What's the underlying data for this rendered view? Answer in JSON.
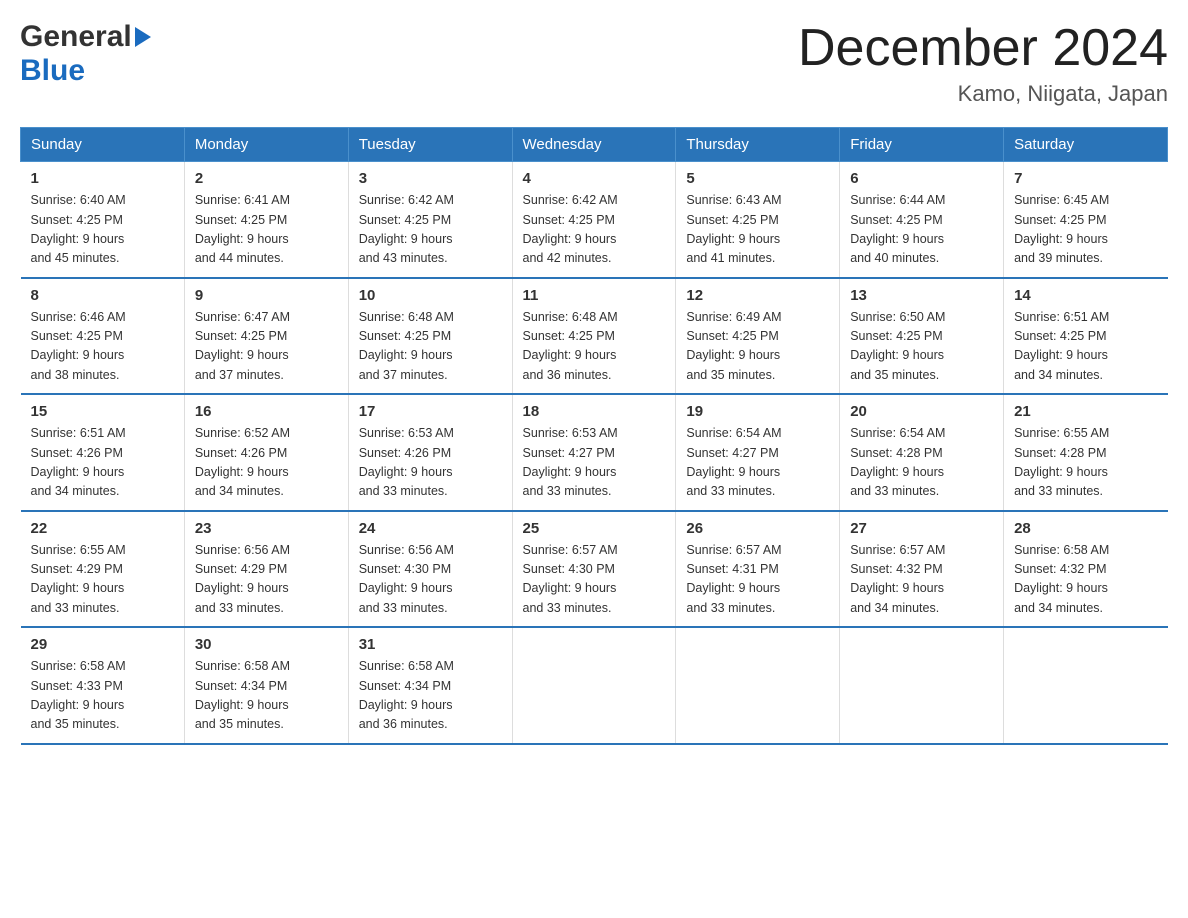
{
  "header": {
    "logo_general": "General",
    "logo_blue": "Blue",
    "title": "December 2024",
    "subtitle": "Kamo, Niigata, Japan"
  },
  "weekdays": [
    "Sunday",
    "Monday",
    "Tuesday",
    "Wednesday",
    "Thursday",
    "Friday",
    "Saturday"
  ],
  "weeks": [
    [
      {
        "day": "1",
        "sunrise": "6:40 AM",
        "sunset": "4:25 PM",
        "daylight": "9 hours and 45 minutes."
      },
      {
        "day": "2",
        "sunrise": "6:41 AM",
        "sunset": "4:25 PM",
        "daylight": "9 hours and 44 minutes."
      },
      {
        "day": "3",
        "sunrise": "6:42 AM",
        "sunset": "4:25 PM",
        "daylight": "9 hours and 43 minutes."
      },
      {
        "day": "4",
        "sunrise": "6:42 AM",
        "sunset": "4:25 PM",
        "daylight": "9 hours and 42 minutes."
      },
      {
        "day": "5",
        "sunrise": "6:43 AM",
        "sunset": "4:25 PM",
        "daylight": "9 hours and 41 minutes."
      },
      {
        "day": "6",
        "sunrise": "6:44 AM",
        "sunset": "4:25 PM",
        "daylight": "9 hours and 40 minutes."
      },
      {
        "day": "7",
        "sunrise": "6:45 AM",
        "sunset": "4:25 PM",
        "daylight": "9 hours and 39 minutes."
      }
    ],
    [
      {
        "day": "8",
        "sunrise": "6:46 AM",
        "sunset": "4:25 PM",
        "daylight": "9 hours and 38 minutes."
      },
      {
        "day": "9",
        "sunrise": "6:47 AM",
        "sunset": "4:25 PM",
        "daylight": "9 hours and 37 minutes."
      },
      {
        "day": "10",
        "sunrise": "6:48 AM",
        "sunset": "4:25 PM",
        "daylight": "9 hours and 37 minutes."
      },
      {
        "day": "11",
        "sunrise": "6:48 AM",
        "sunset": "4:25 PM",
        "daylight": "9 hours and 36 minutes."
      },
      {
        "day": "12",
        "sunrise": "6:49 AM",
        "sunset": "4:25 PM",
        "daylight": "9 hours and 35 minutes."
      },
      {
        "day": "13",
        "sunrise": "6:50 AM",
        "sunset": "4:25 PM",
        "daylight": "9 hours and 35 minutes."
      },
      {
        "day": "14",
        "sunrise": "6:51 AM",
        "sunset": "4:25 PM",
        "daylight": "9 hours and 34 minutes."
      }
    ],
    [
      {
        "day": "15",
        "sunrise": "6:51 AM",
        "sunset": "4:26 PM",
        "daylight": "9 hours and 34 minutes."
      },
      {
        "day": "16",
        "sunrise": "6:52 AM",
        "sunset": "4:26 PM",
        "daylight": "9 hours and 34 minutes."
      },
      {
        "day": "17",
        "sunrise": "6:53 AM",
        "sunset": "4:26 PM",
        "daylight": "9 hours and 33 minutes."
      },
      {
        "day": "18",
        "sunrise": "6:53 AM",
        "sunset": "4:27 PM",
        "daylight": "9 hours and 33 minutes."
      },
      {
        "day": "19",
        "sunrise": "6:54 AM",
        "sunset": "4:27 PM",
        "daylight": "9 hours and 33 minutes."
      },
      {
        "day": "20",
        "sunrise": "6:54 AM",
        "sunset": "4:28 PM",
        "daylight": "9 hours and 33 minutes."
      },
      {
        "day": "21",
        "sunrise": "6:55 AM",
        "sunset": "4:28 PM",
        "daylight": "9 hours and 33 minutes."
      }
    ],
    [
      {
        "day": "22",
        "sunrise": "6:55 AM",
        "sunset": "4:29 PM",
        "daylight": "9 hours and 33 minutes."
      },
      {
        "day": "23",
        "sunrise": "6:56 AM",
        "sunset": "4:29 PM",
        "daylight": "9 hours and 33 minutes."
      },
      {
        "day": "24",
        "sunrise": "6:56 AM",
        "sunset": "4:30 PM",
        "daylight": "9 hours and 33 minutes."
      },
      {
        "day": "25",
        "sunrise": "6:57 AM",
        "sunset": "4:30 PM",
        "daylight": "9 hours and 33 minutes."
      },
      {
        "day": "26",
        "sunrise": "6:57 AM",
        "sunset": "4:31 PM",
        "daylight": "9 hours and 33 minutes."
      },
      {
        "day": "27",
        "sunrise": "6:57 AM",
        "sunset": "4:32 PM",
        "daylight": "9 hours and 34 minutes."
      },
      {
        "day": "28",
        "sunrise": "6:58 AM",
        "sunset": "4:32 PM",
        "daylight": "9 hours and 34 minutes."
      }
    ],
    [
      {
        "day": "29",
        "sunrise": "6:58 AM",
        "sunset": "4:33 PM",
        "daylight": "9 hours and 35 minutes."
      },
      {
        "day": "30",
        "sunrise": "6:58 AM",
        "sunset": "4:34 PM",
        "daylight": "9 hours and 35 minutes."
      },
      {
        "day": "31",
        "sunrise": "6:58 AM",
        "sunset": "4:34 PM",
        "daylight": "9 hours and 36 minutes."
      },
      null,
      null,
      null,
      null
    ]
  ],
  "labels": {
    "sunrise": "Sunrise:",
    "sunset": "Sunset:",
    "daylight": "Daylight:"
  }
}
